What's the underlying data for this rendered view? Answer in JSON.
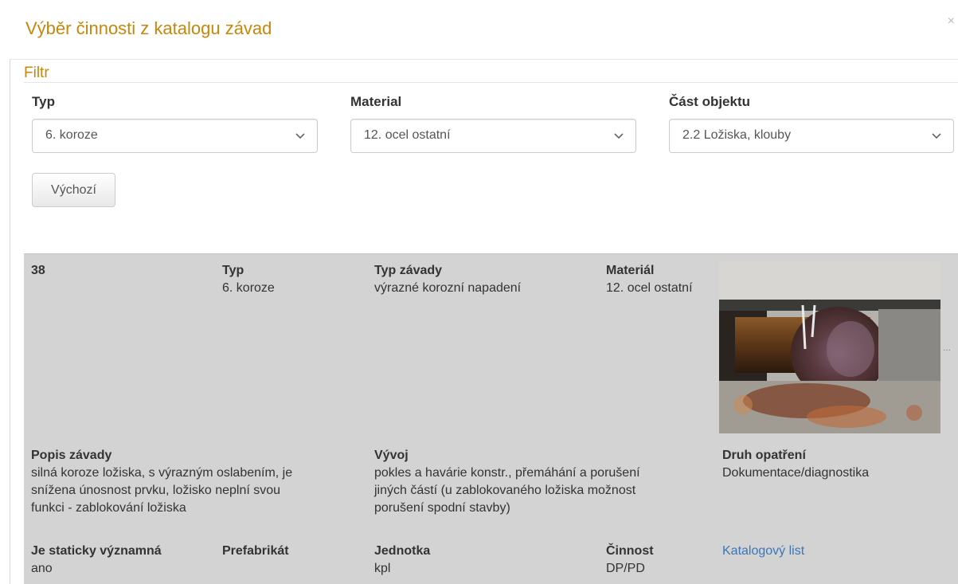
{
  "modal": {
    "title": "Výběr činnosti z katalogu závad",
    "close": "×"
  },
  "filter": {
    "legend": "Filtr",
    "typ": {
      "label": "Typ",
      "value": "6. koroze"
    },
    "material": {
      "label": "Material",
      "value": "12. ocel ostatní"
    },
    "cast": {
      "label": "Část objektu",
      "value": "2.2 Ložiska, klouby"
    },
    "default_button": "Výchozí"
  },
  "record": {
    "id": "38",
    "typ": {
      "label": "Typ",
      "value": "6. koroze"
    },
    "typ_zavady": {
      "label": "Typ závady",
      "value": "výrazné korozní napadení"
    },
    "material": {
      "label": "Materiál",
      "value": "12. ocel ostatní"
    },
    "popis": {
      "label": "Popis závady",
      "lines": [
        "silná koroze ložiska, s výrazným oslabením, je",
        "snížena únosnost prvku, ložisko neplní svou",
        "funkci - zablokování ložiska"
      ]
    },
    "vyvoj": {
      "label": "Vývoj",
      "lines": [
        "pokles a havárie konstr., přemáhání a porušení",
        "jiných částí (u zablokovaného ložiska možnost",
        "porušení spodní stavby)"
      ]
    },
    "druh": {
      "label": "Druh opatření",
      "value": "Dokumentace/diagnostika"
    },
    "staticky": {
      "label": "Je staticky významná",
      "value": "ano"
    },
    "prefabrikat": {
      "label": "Prefabrikát",
      "value": ""
    },
    "jednotka": {
      "label": "Jednotka",
      "value": "kpl"
    },
    "cinnost": {
      "label": "Činnost",
      "value": "DP/PD"
    },
    "katalog_link": "Katalogový list",
    "more": "..."
  }
}
